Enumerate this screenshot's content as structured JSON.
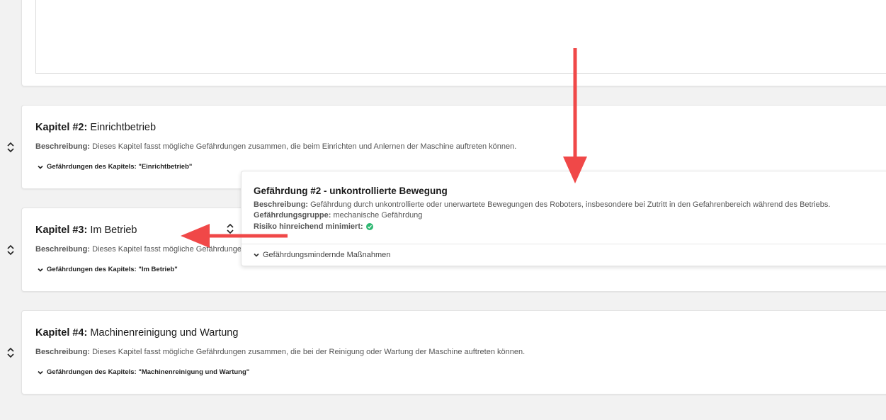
{
  "chapters": [
    {
      "title_prefix": "Kapitel #2:",
      "title": "Einrichtbetrieb",
      "desc_label": "Beschreibung:",
      "desc": "Dieses Kapitel fasst mögliche Gefährdungen zusammen, die beim Einrichten und Anlernen der Maschine auftreten können.",
      "hazards_toggle": "Gefährdungen des Kapitels: \"Einrichtbetrieb\""
    },
    {
      "title_prefix": "Kapitel #3:",
      "title": "Im Betrieb",
      "desc_label": "Beschreibung:",
      "desc": "Dieses Kapitel fasst mögliche Gefährdungen",
      "hazards_toggle": "Gefährdungen des Kapitels: \"Im Betrieb\""
    },
    {
      "title_prefix": "Kapitel #4:",
      "title": "Machinenreinigung und Wartung",
      "desc_label": "Beschreibung:",
      "desc": "Dieses Kapitel fasst mögliche Gefährdungen zusammen, die bei der Reinigung oder Wartung der Maschine auftreten können.",
      "hazards_toggle": "Gefährdungen des Kapitels: \"Machinenreinigung und Wartung\""
    }
  ],
  "hazard": {
    "title": "Gefährdung #2 - unkontrollierte Bewegung",
    "desc_label": "Beschreibung:",
    "desc": "Gefährdung durch unkontrollierte oder unerwartete Bewegungen des Roboters, insbesondere bei Zutritt in den Gefahrenbereich während des Betriebs.",
    "group_label": "Gefährdungsgruppe:",
    "group": "mechanische Gefährdung",
    "risk_label": "Risiko hinreichend minimiert:",
    "measures_toggle": "Gefährdungsmindernde Maßnahmen"
  },
  "colors": {
    "arrow": "#f04848",
    "check": "#2eb872"
  }
}
